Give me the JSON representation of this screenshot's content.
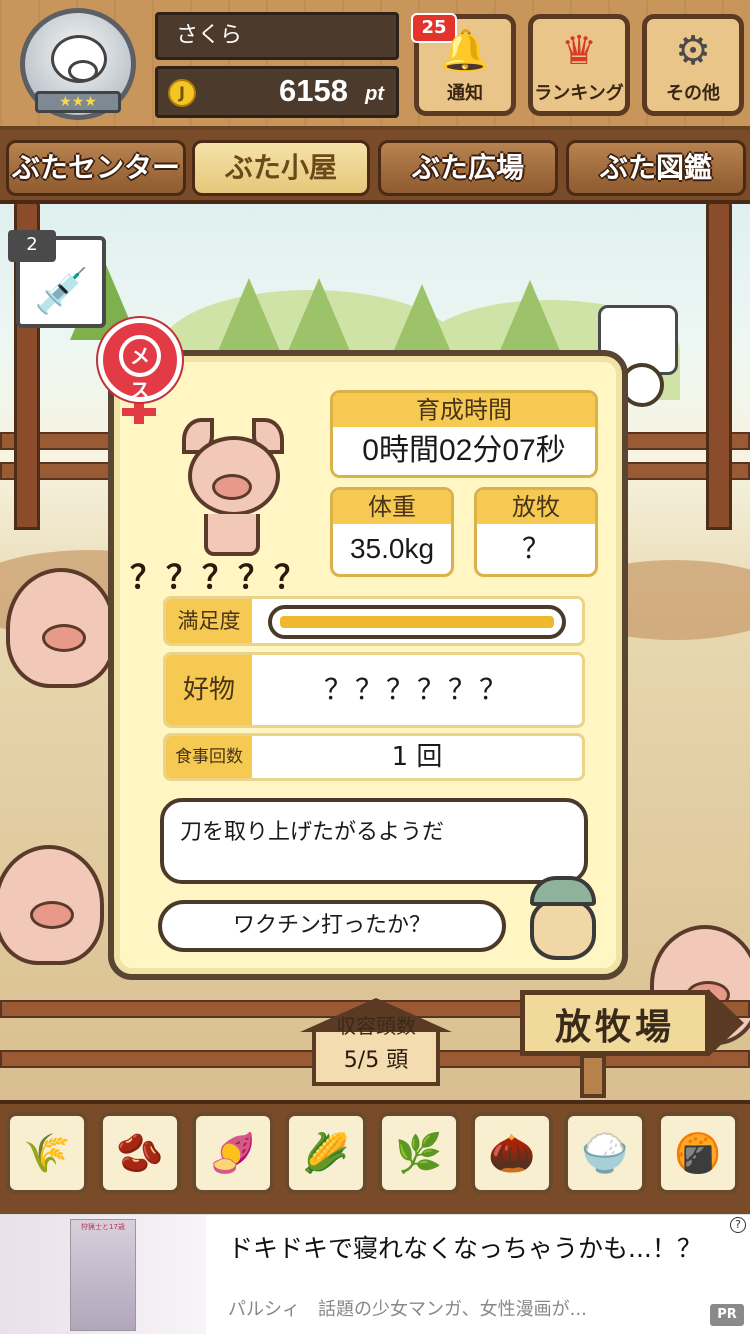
{
  "header": {
    "avatar_stars": "★★★",
    "player_name": "さくら",
    "points": "6158",
    "points_unit": "pt",
    "coin_icon": "coin-icon",
    "buttons": [
      {
        "label": "通知",
        "icon": "bell-icon",
        "badge": "25"
      },
      {
        "label": "ランキング",
        "icon": "crown-icon"
      },
      {
        "label": "その他",
        "icon": "gear-icon"
      }
    ]
  },
  "tabs": [
    {
      "label": "ぶたセンター",
      "active": false
    },
    {
      "label": "ぶた小屋",
      "active": true
    },
    {
      "label": "ぶた広場",
      "active": false
    },
    {
      "label": "ぶた図鑑",
      "active": false
    }
  ],
  "side_item": {
    "count": "2",
    "icon": "syringe-icon"
  },
  "pig": {
    "gender_label": "メス",
    "name": "？？？？？",
    "growth_time_label": "育成時間",
    "growth_time": "0時間02分07秒",
    "weight_label": "体重",
    "weight": "35.0kg",
    "grazing_label": "放牧",
    "grazing": "？",
    "satisfaction_label": "満足度",
    "satisfaction_level": 1.0,
    "favorite_label": "好物",
    "favorite": "？？？？？？",
    "meals_label": "食事回数",
    "meals": "1 回",
    "message": "刀を取り上げたがるようだ",
    "farmer_question": "ワクチン打ったか？"
  },
  "capacity": {
    "label": "収容頭数",
    "value": "5/5 頭"
  },
  "signpost": {
    "label": "放牧場"
  },
  "feeds": [
    {
      "icon": "grain-pile-icon"
    },
    {
      "icon": "mixed-grain-icon"
    },
    {
      "icon": "sweet-potato-icon"
    },
    {
      "icon": "corn-icon"
    },
    {
      "icon": "soybean-icon"
    },
    {
      "icon": "acorn-icon"
    },
    {
      "icon": "grain-plate-icon"
    },
    {
      "icon": "truffle-plate-icon"
    }
  ],
  "ad": {
    "thumb_text": "狩猟士と17歳",
    "title": "ドキドキで寝れなくなっちゃうかも...！？",
    "subtitle": "パルシィ　話題の少女マンガ、女性漫画が...",
    "pr": "PR",
    "info": "?"
  },
  "colors": {
    "wood_dark": "#7a4b28",
    "panel": "#fff6c4",
    "accent_yellow": "#f6c953",
    "badge_red": "#e2342b",
    "female_red": "#e23b45"
  }
}
